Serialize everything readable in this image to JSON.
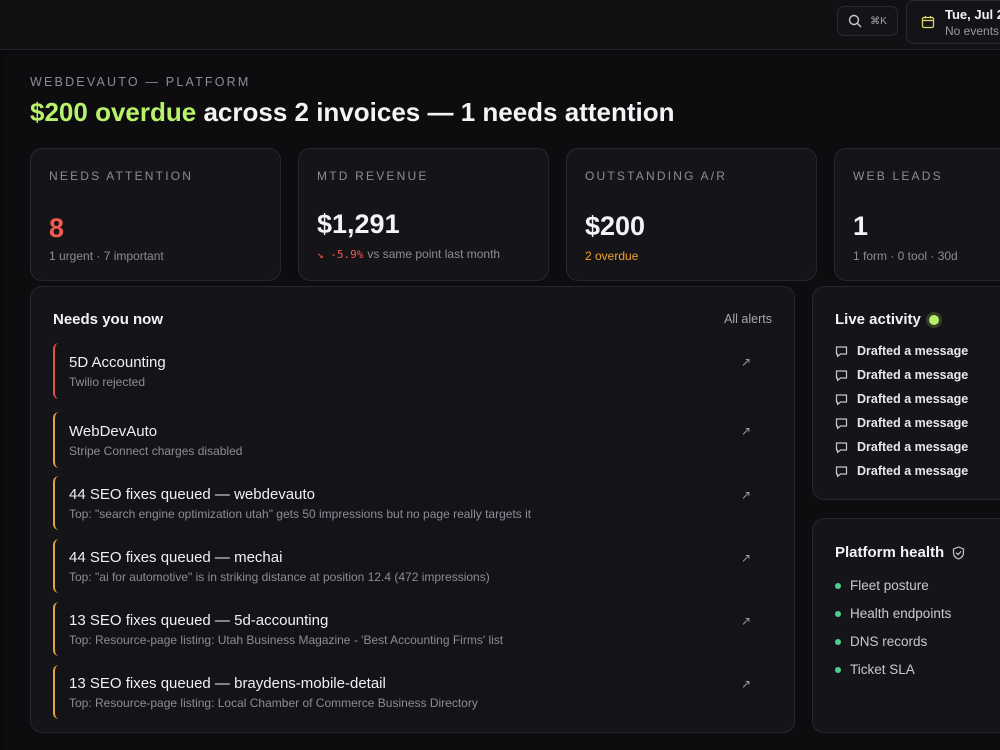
{
  "topbar": {
    "search_shortcut": "⌘K",
    "date_main": "Tue, Jul 2",
    "date_sub": "No events"
  },
  "header": {
    "eyebrow": "WEBDEVAUTO — PLATFORM",
    "headline_accent": "$200 overdue",
    "headline_rest": " across 2 invoices — 1 needs attention"
  },
  "stats": [
    {
      "label": "NEEDS ATTENTION",
      "value": "8",
      "sub": "1 urgent · 7 important"
    },
    {
      "label": "MTD REVENUE",
      "value": "$1,291",
      "delta": "↘ -5.9%",
      "sub": "vs same point last month"
    },
    {
      "label": "OUTSTANDING A/R",
      "value": "$200",
      "sub": "2 overdue"
    },
    {
      "label": "WEB LEADS",
      "value": "1",
      "sub": "1 form · 0 tool · 30d"
    }
  ],
  "needs": {
    "title": "Needs you now",
    "all_alerts": "All alerts",
    "items": [
      {
        "title": "5D Accounting",
        "desc": "Twilio rejected",
        "severity": "urgent"
      },
      {
        "title": "WebDevAuto",
        "desc": "Stripe Connect charges disabled",
        "severity": "important"
      },
      {
        "title": "44 SEO fixes queued — webdevauto",
        "desc": "Top: \"search engine optimization utah\" gets 50 impressions but no page really targets it",
        "severity": "important"
      },
      {
        "title": "44 SEO fixes queued — mechai",
        "desc": "Top: \"ai for automotive\" is in striking distance at position 12.4 (472 impressions)",
        "severity": "important"
      },
      {
        "title": "13 SEO fixes queued — 5d-accounting",
        "desc": "Top: Resource-page listing: Utah Business Magazine - 'Best Accounting Firms' list",
        "severity": "important"
      },
      {
        "title": "13 SEO fixes queued — braydens-mobile-detail",
        "desc": "Top: Resource-page listing: Local Chamber of Commerce Business Directory",
        "severity": "important"
      }
    ]
  },
  "activity": {
    "title": "Live activity",
    "items": [
      "Drafted a message",
      "Drafted a message",
      "Drafted a message",
      "Drafted a message",
      "Drafted a message",
      "Drafted a message"
    ]
  },
  "health": {
    "title": "Platform health",
    "items": [
      "Fleet posture",
      "Health endpoints",
      "DNS records",
      "Ticket SLA"
    ]
  },
  "colors": {
    "accent": "#b8f26a",
    "urgent": "#e0534a",
    "important": "#e6a23c",
    "healthy": "#4ccf8a"
  }
}
